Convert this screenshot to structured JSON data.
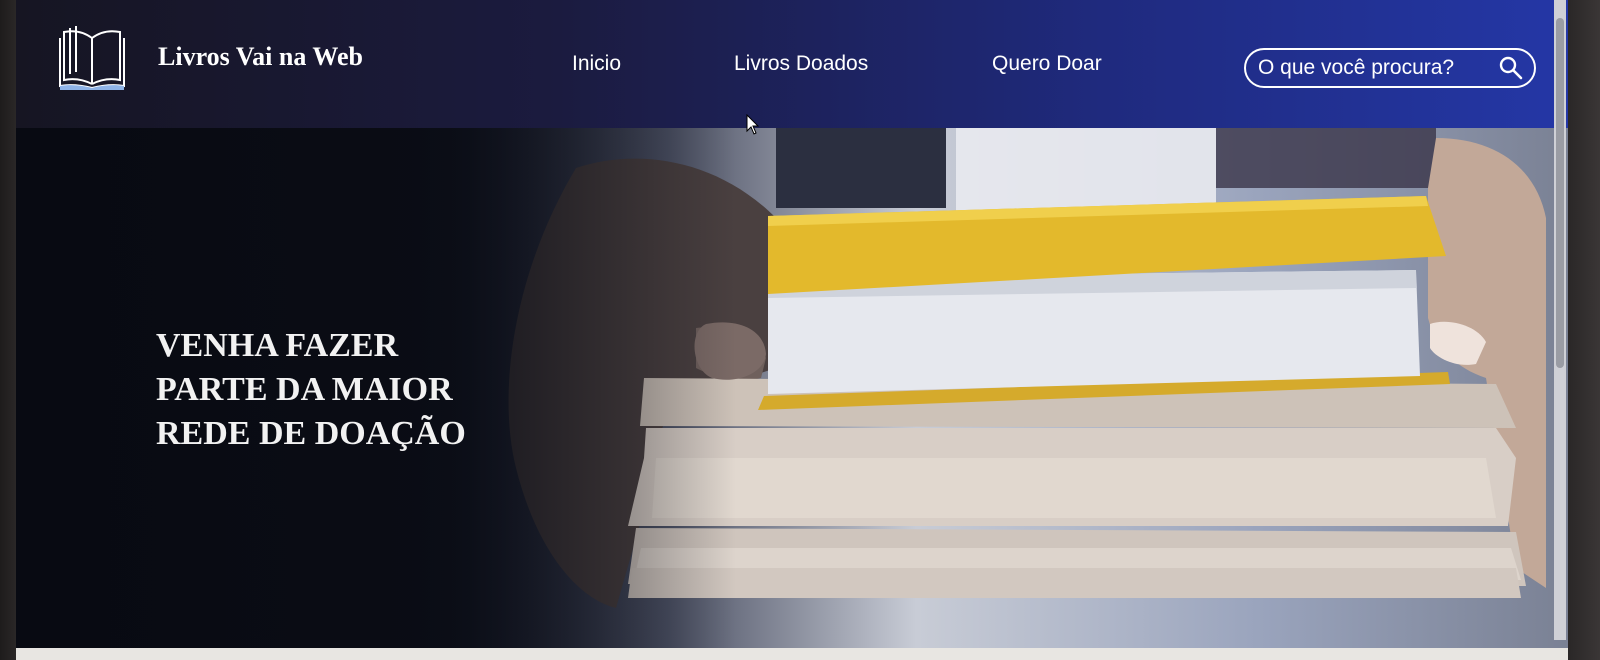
{
  "header": {
    "brand": "Livros Vai na Web",
    "nav": [
      {
        "label": "Inicio"
      },
      {
        "label": "Livros Doados"
      },
      {
        "label": "Quero Doar"
      }
    ],
    "search": {
      "placeholder": "O que você procura?"
    }
  },
  "hero": {
    "title": "VENHA FAZER PARTE DA MAIOR REDE DE DOAÇÃO"
  },
  "icons": [
    "book-logo-icon",
    "search-icon",
    "mouse-cursor-icon"
  ],
  "colors": {
    "header_start": "#161522",
    "header_end": "#2437a6",
    "book_yellow": "#e3b92c",
    "text": "#ffffff"
  }
}
